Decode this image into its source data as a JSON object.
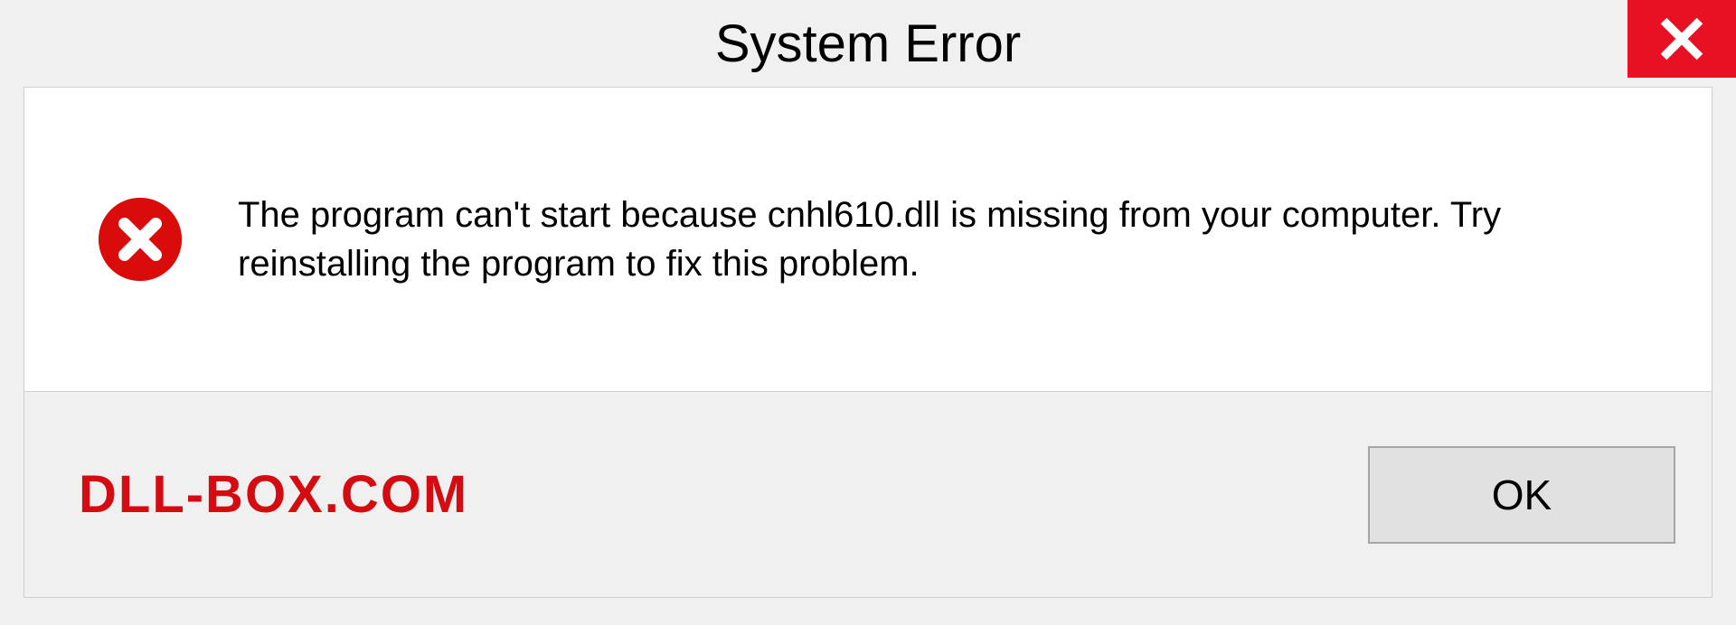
{
  "dialog": {
    "title": "System Error",
    "message": "The program can't start because cnhl610.dll is missing from your computer. Try reinstalling the program to fix this problem.",
    "ok_label": "OK"
  },
  "watermark": "DLL-BOX.COM",
  "colors": {
    "close_bg": "#e81123",
    "error_icon": "#da0b0b",
    "watermark": "#d40c12"
  }
}
